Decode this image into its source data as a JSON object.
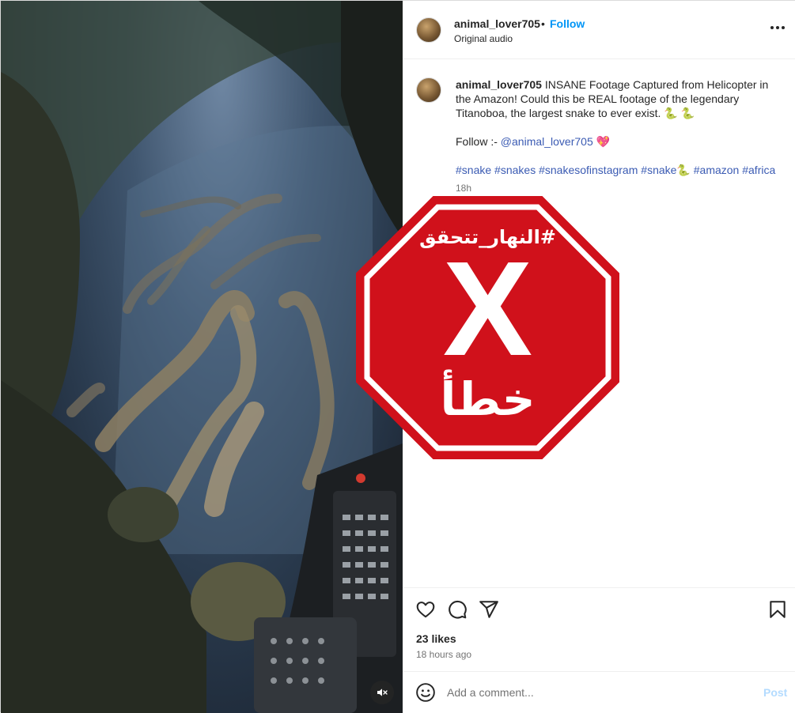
{
  "post": {
    "username": "animal_lover705",
    "separator": "•",
    "follow_label": "Follow",
    "audio_label": "Original audio",
    "caption_text": "INSANE Footage Captured from Helicopter in the Amazon! Could this be REAL footage of the legendary Titanoboa, the largest snake to ever exist. 🐍 🐍",
    "follow_prefix": "Follow :-",
    "mention": "@animal_lover705",
    "heart_emoji": "💖",
    "hashtags": [
      "#snake",
      "#snakes",
      "#snakesofinstagram",
      "#snake🐍",
      "#amazon",
      "#africa"
    ],
    "time_short": "18h",
    "likes": "23 likes",
    "time_long": "18 hours ago"
  },
  "comment": {
    "placeholder": "Add a comment...",
    "post_label": "Post"
  },
  "overlay": {
    "hashtag": "#النهار_تتحقق",
    "mark": "X",
    "verdict": "خطأ",
    "color": "#d0111b"
  },
  "icons": {
    "more": "more-options-icon",
    "like": "heart-icon",
    "comment": "comment-bubble-icon",
    "share": "paper-plane-icon",
    "save": "bookmark-icon",
    "emoji": "smiley-icon",
    "mute": "speaker-muted-icon"
  }
}
